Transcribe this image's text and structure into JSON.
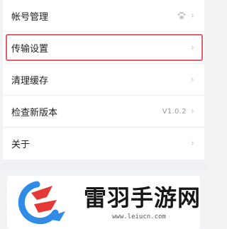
{
  "settings": {
    "items": [
      {
        "label": "帐号管理",
        "value": "",
        "icon": "paw-icon"
      },
      {
        "label": "传输设置",
        "value": "",
        "highlighted": true
      },
      {
        "label": "清理缓存",
        "value": ""
      },
      {
        "label": "检查新版本",
        "value": "V1.0.2"
      },
      {
        "label": "关于",
        "value": ""
      }
    ],
    "chevron": "›"
  },
  "watermark": {
    "brand": "雷羽手游网",
    "url": "www.leiucn.com"
  },
  "colors": {
    "highlight_border": "#e0626d",
    "logo_blue": "#2f8be6",
    "logo_red": "#e53935"
  }
}
